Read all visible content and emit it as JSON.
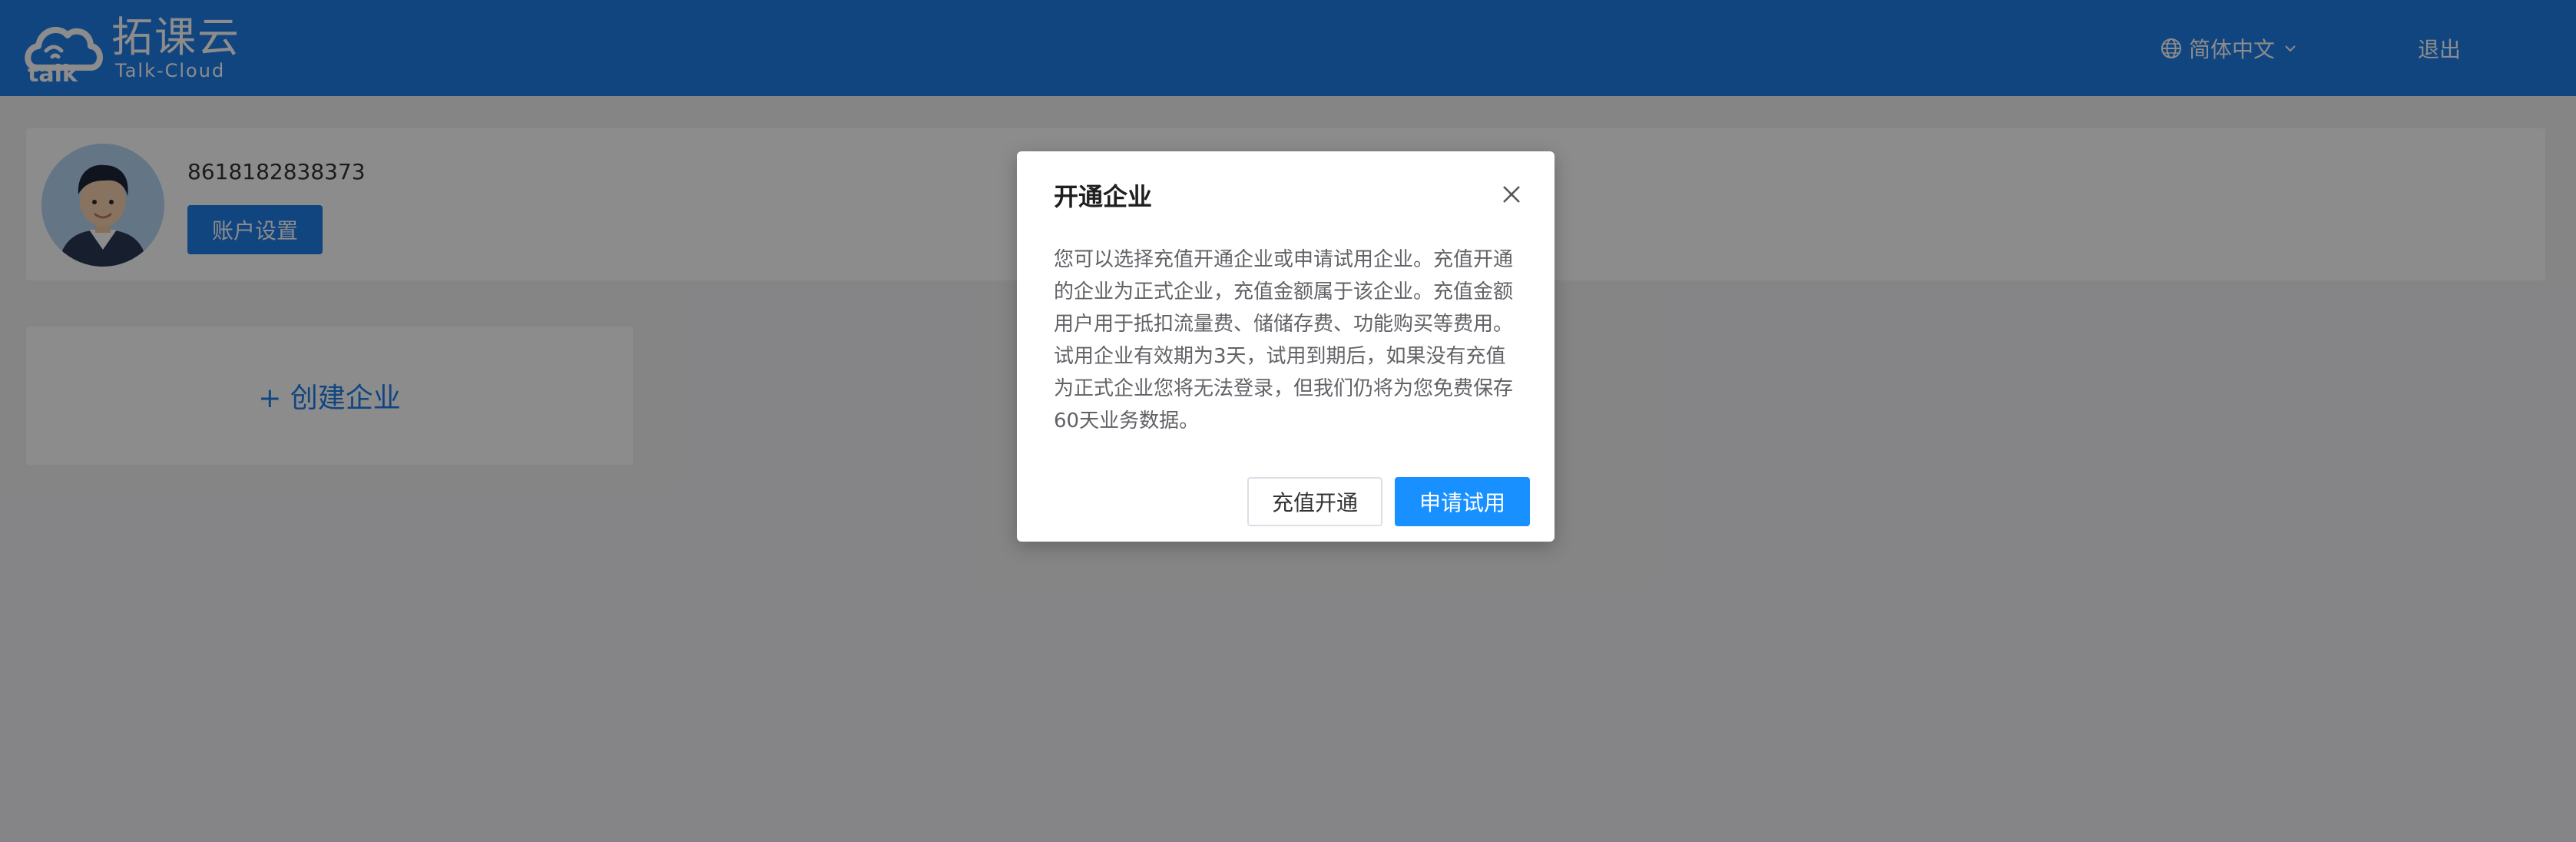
{
  "header": {
    "logo_cn": "拓课云",
    "logo_en": "Talk-Cloud",
    "language": "简体中文",
    "logout": "退出"
  },
  "profile": {
    "phone": "8618182838373",
    "account_settings": "账户设置"
  },
  "create_enterprise": "+ 创建企业",
  "modal": {
    "title": "开通企业",
    "body": "您可以选择充值开通企业或申请试用企业。充值开通的企业为正式企业，充值金额属于该企业。充值金额用户用于抵扣流量费、储储存费、功能购买等费用。试用企业有效期为3天，试用到期后，如果没有充值为正式企业您将无法登录，但我们仍将为您免费保存60天业务数据。",
    "recharge_button": "充值开通",
    "trial_button": "申请试用"
  },
  "colors": {
    "header_bg": "#1f7ee9",
    "primary_button": "#1890ff",
    "overlay": "rgba(0,0,0,0.45)"
  },
  "icons": {
    "logo": "cloud-logo-icon",
    "language": "globe-icon",
    "language_dropdown": "chevron-down-icon",
    "close": "close-icon",
    "avatar": "user-avatar"
  }
}
